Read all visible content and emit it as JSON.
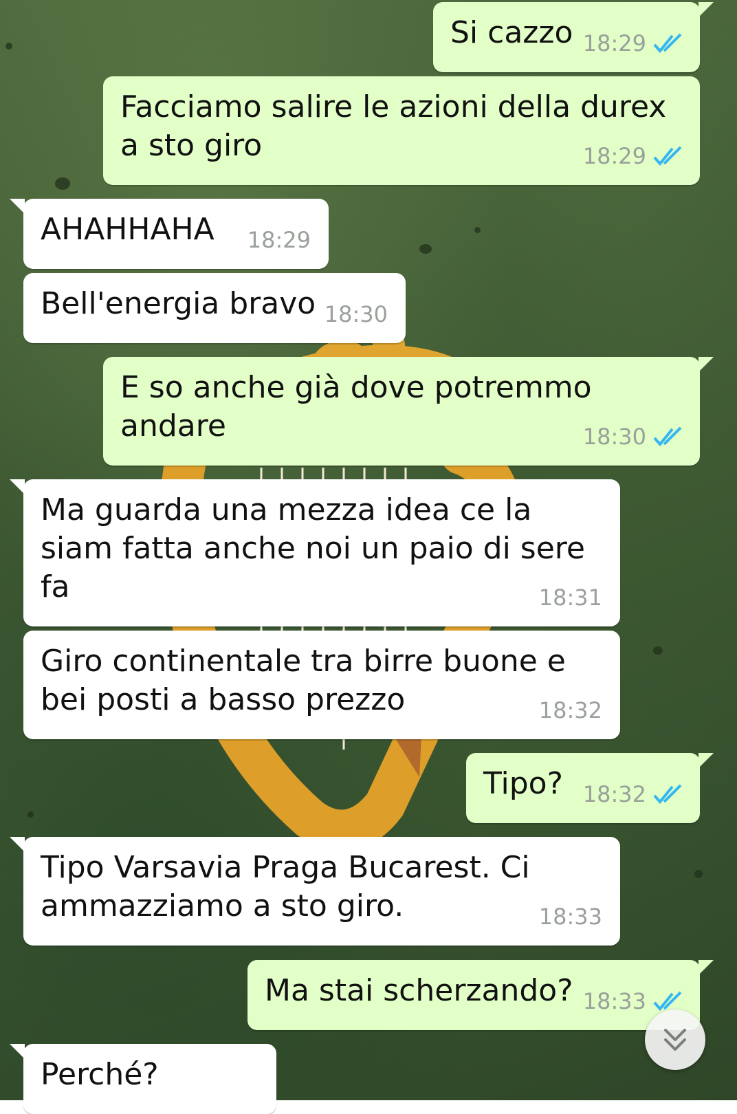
{
  "messages": [
    {
      "direction": "out",
      "text": "Si cazzo",
      "time": "18:29",
      "status_icon": "double-check-read-icon"
    },
    {
      "direction": "out",
      "text": "Facciamo salire le azioni della durex a sto giro",
      "time": "18:29",
      "status_icon": "double-check-read-icon"
    },
    {
      "direction": "in",
      "text": "AHAHHAHA",
      "time": "18:29"
    },
    {
      "direction": "in",
      "text": "Bell'energia bravo",
      "time": "18:30"
    },
    {
      "direction": "out",
      "text": "E so anche già dove potremmo andare",
      "time": "18:30",
      "status_icon": "double-check-read-icon"
    },
    {
      "direction": "in",
      "text": "Ma guarda una mezza idea ce la siam fatta anche noi un paio di sere fa",
      "time": "18:31"
    },
    {
      "direction": "in",
      "text": "Giro continentale tra birre buone e bei posti a basso prezzo",
      "time": "18:32"
    },
    {
      "direction": "out",
      "text": "Tipo?",
      "time": "18:32",
      "status_icon": "double-check-read-icon"
    },
    {
      "direction": "in",
      "text": "Tipo Varsavia Praga Bucarest. Ci ammazziamo a sto giro.",
      "time": "18:33"
    },
    {
      "direction": "out",
      "text": "Ma stai scherzando?",
      "time": "18:33",
      "status_icon": "double-check-read-icon"
    },
    {
      "direction": "in",
      "text": "Perché?",
      "time": ""
    }
  ],
  "colors": {
    "incoming_bubble": "#ffffff",
    "outgoing_bubble": "#e2ffc8",
    "read_ticks": "#34b7f1",
    "timestamp": "#9aa09a"
  },
  "scroll_button": {
    "icon": "double-chevron-down-icon"
  }
}
